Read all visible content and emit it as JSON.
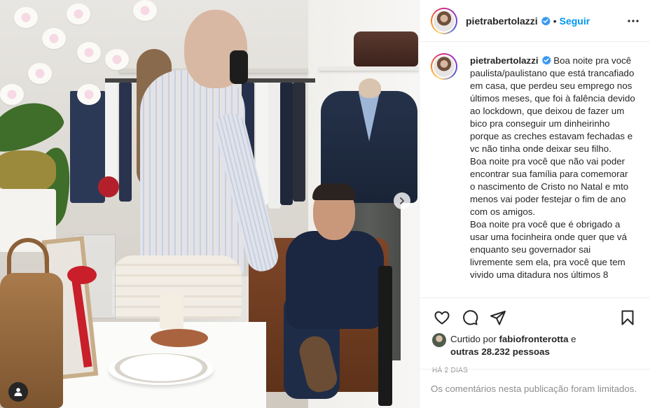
{
  "media": {
    "next_icon": "chevron-right-icon",
    "tag_icon": "user-tag-icon"
  },
  "post_header": {
    "username": "pietrabertolazzi",
    "verified_icon": "verified-badge-icon",
    "separator": "•",
    "follow_label": "Seguir",
    "more_icon": "more-horizontal-icon"
  },
  "caption": {
    "username": "pietrabertolazzi",
    "text": "Boa noite pra você paulista/paulistano que está trancafiado em casa, que perdeu seu emprego nos últimos meses, que foi à falência devido ao lockdown, que deixou de fazer um bico pra conseguir um dinheirinho porque as creches estavam fechadas e vc não tinha onde deixar seu filho.\nBoa noite pra você que não vai poder encontrar sua família para comemorar o nascimento de Cristo no Natal e mto menos vai poder festejar o fim de ano com os amigos.\nBoa noite pra você que é obrigado a usar uma focinheira onde quer que vá enquanto seu governador sai livremente sem ela, pra você que tem vivido uma ditadura nos últimos 8"
  },
  "actions": {
    "like_icon": "heart-icon",
    "comment_icon": "comment-icon",
    "share_icon": "paper-plane-icon",
    "save_icon": "bookmark-icon"
  },
  "likes": {
    "prefix": "Curtido por ",
    "user": "fabiofronterotta",
    "mid": " e",
    "others": "outras 28.232 pessoas"
  },
  "timestamp": "HÁ 2 DIAS",
  "comments_limited": "Os comentários nesta publicação foram limitados.",
  "colors": {
    "accent": "#0095f6",
    "text": "#262626",
    "muted": "#8e8e8e",
    "border": "#efefef"
  }
}
